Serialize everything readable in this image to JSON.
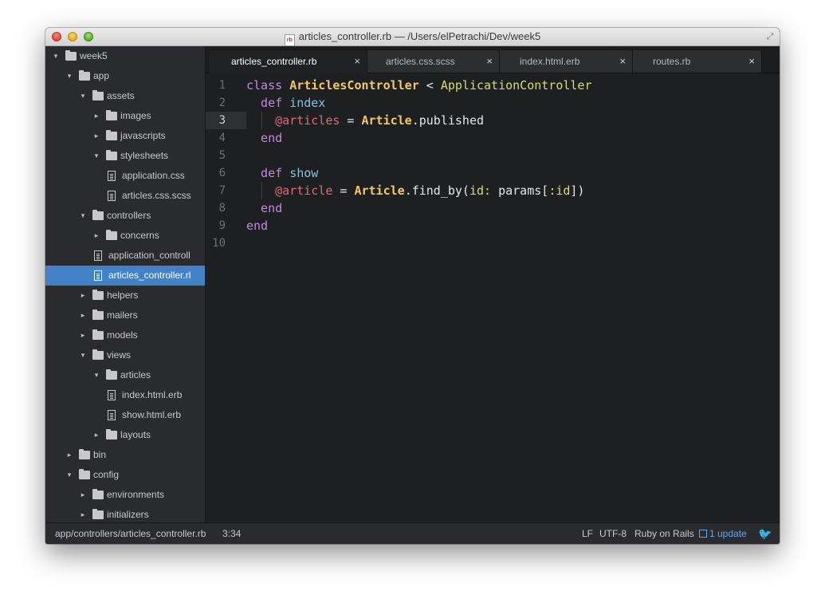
{
  "window": {
    "title": "articles_controller.rb — /Users/elPetrachi/Dev/week5",
    "title_file_badge": "rb"
  },
  "tree": [
    {
      "label": "week5",
      "type": "folder",
      "depth": 0,
      "expanded": true
    },
    {
      "label": "app",
      "type": "folder",
      "depth": 1,
      "expanded": true
    },
    {
      "label": "assets",
      "type": "folder",
      "depth": 2,
      "expanded": true
    },
    {
      "label": "images",
      "type": "folder",
      "depth": 3,
      "expanded": false
    },
    {
      "label": "javascripts",
      "type": "folder",
      "depth": 3,
      "expanded": false
    },
    {
      "label": "stylesheets",
      "type": "folder",
      "depth": 3,
      "expanded": true
    },
    {
      "label": "application.css",
      "type": "file",
      "depth": 4
    },
    {
      "label": "articles.css.scss",
      "type": "file",
      "depth": 4
    },
    {
      "label": "controllers",
      "type": "folder",
      "depth": 2,
      "expanded": true
    },
    {
      "label": "concerns",
      "type": "folder",
      "depth": 3,
      "expanded": false
    },
    {
      "label": "application_controll",
      "type": "file",
      "depth": 3
    },
    {
      "label": "articles_controller.rl",
      "type": "file",
      "depth": 3,
      "selected": true
    },
    {
      "label": "helpers",
      "type": "folder",
      "depth": 2,
      "expanded": false
    },
    {
      "label": "mailers",
      "type": "folder",
      "depth": 2,
      "expanded": false
    },
    {
      "label": "models",
      "type": "folder",
      "depth": 2,
      "expanded": false
    },
    {
      "label": "views",
      "type": "folder",
      "depth": 2,
      "expanded": true
    },
    {
      "label": "articles",
      "type": "folder",
      "depth": 3,
      "expanded": true
    },
    {
      "label": "index.html.erb",
      "type": "file",
      "depth": 4
    },
    {
      "label": "show.html.erb",
      "type": "file",
      "depth": 4
    },
    {
      "label": "layouts",
      "type": "folder",
      "depth": 3,
      "expanded": false
    },
    {
      "label": "bin",
      "type": "folder",
      "depth": 1,
      "expanded": false
    },
    {
      "label": "config",
      "type": "folder",
      "depth": 1,
      "expanded": true
    },
    {
      "label": "environments",
      "type": "folder",
      "depth": 2,
      "expanded": false
    },
    {
      "label": "initializers",
      "type": "folder",
      "depth": 2,
      "expanded": false
    }
  ],
  "tabs": [
    {
      "label": "articles_controller.rb",
      "active": true,
      "close": "×"
    },
    {
      "label": "articles.css.scss",
      "active": false,
      "close": "×"
    },
    {
      "label": "index.html.erb",
      "active": false,
      "close": "×"
    },
    {
      "label": "routes.rb",
      "active": false,
      "close": "×"
    }
  ],
  "editor": {
    "current_line": 3,
    "lines": [
      {
        "num": "1",
        "tokens": [
          [
            "kw",
            "class "
          ],
          [
            "cls",
            "ArticlesController"
          ],
          [
            "op",
            " < "
          ],
          [
            "sup",
            "ApplicationController"
          ]
        ]
      },
      {
        "num": "2",
        "tokens": [
          [
            "kw",
            "  def "
          ],
          [
            "meth",
            "index"
          ]
        ]
      },
      {
        "num": "3",
        "tokens": [
          [
            "op",
            "    "
          ],
          [
            "ivar",
            "@articles"
          ],
          [
            "op",
            " = "
          ],
          [
            "cls",
            "Article"
          ],
          [
            "op",
            ".published"
          ]
        ]
      },
      {
        "num": "4",
        "tokens": [
          [
            "kw",
            "  end"
          ]
        ]
      },
      {
        "num": "5",
        "tokens": []
      },
      {
        "num": "6",
        "tokens": [
          [
            "kw",
            "  def "
          ],
          [
            "meth",
            "show"
          ]
        ]
      },
      {
        "num": "7",
        "tokens": [
          [
            "op",
            "    "
          ],
          [
            "ivar",
            "@article"
          ],
          [
            "op",
            " = "
          ],
          [
            "cls",
            "Article"
          ],
          [
            "op",
            ".find_by("
          ],
          [
            "sym",
            "id:"
          ],
          [
            "op",
            " params["
          ],
          [
            "sym",
            ":id"
          ],
          [
            "op",
            "])"
          ]
        ]
      },
      {
        "num": "8",
        "tokens": [
          [
            "kw",
            "  end"
          ]
        ]
      },
      {
        "num": "9",
        "tokens": [
          [
            "kw",
            "end"
          ]
        ]
      },
      {
        "num": "10",
        "tokens": []
      }
    ]
  },
  "status": {
    "path": "app/controllers/articles_controller.rb",
    "cursor": "3:34",
    "line_ending": "LF",
    "encoding": "UTF-8",
    "grammar": "Ruby on Rails",
    "updates": "1 update"
  },
  "icons": {
    "folder": "folder-icon",
    "file": "file-icon",
    "bird": "bird-icon",
    "package": "package-icon"
  },
  "colors": {
    "selection": "#4182c8",
    "keyword": "#c388e6",
    "class": "#f2c966",
    "ivar": "#e06b75",
    "method": "#7ec3e6",
    "symbol": "#d8dd6e",
    "link": "#5aa9f0"
  }
}
